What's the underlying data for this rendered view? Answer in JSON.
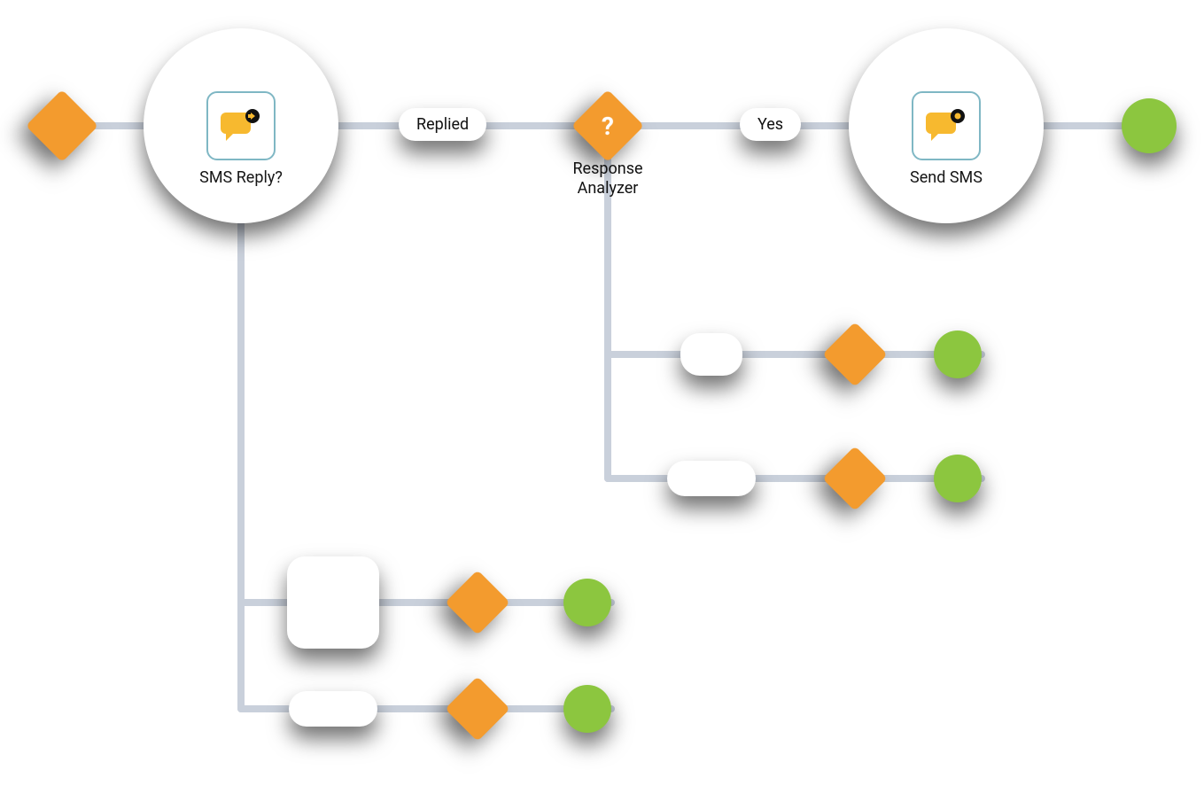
{
  "colors": {
    "line": "#c9d0db",
    "diamond": "#f39b2e",
    "endpoint": "#8cc63f",
    "node_border": "#7fb7c4"
  },
  "nodes": {
    "sms_reply": {
      "label": "SMS Reply?",
      "icon": "sms-reply-icon"
    },
    "send_sms": {
      "label": "Send SMS",
      "icon": "send-sms-icon"
    }
  },
  "decision": {
    "response_analyzer": {
      "label_line1": "Response",
      "label_line2": "Analyzer",
      "glyph": "?"
    }
  },
  "edges": {
    "replied": "Replied",
    "yes": "Yes"
  }
}
